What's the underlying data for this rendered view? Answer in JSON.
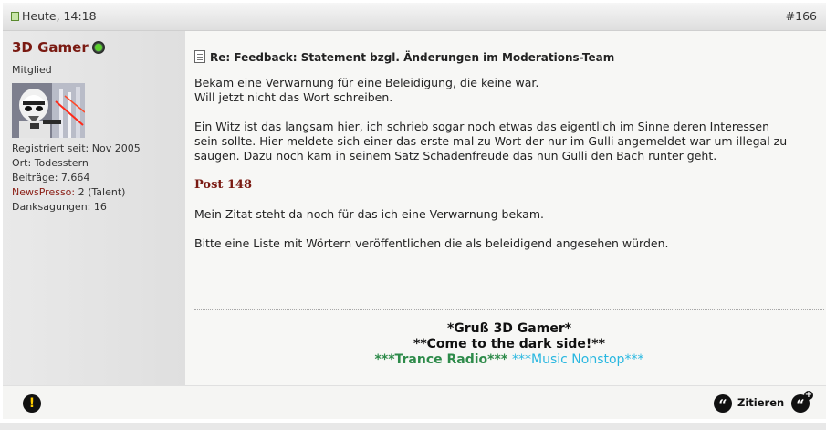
{
  "header": {
    "date": "Heute, 14:18",
    "post_number": "#166"
  },
  "user": {
    "name": "3D Gamer",
    "title": "Mitglied",
    "status": "online",
    "stats": {
      "registered_label": "Registriert seit:",
      "registered_value": "Nov 2005",
      "location_label": "Ort:",
      "location_value": "Todesstern",
      "posts_label": "Beiträge:",
      "posts_value": "7.664",
      "newspresso_label": "NewsPresso:",
      "newspresso_value": "2 (Talent)",
      "thanks_label": "Danksagungen:",
      "thanks_value": "16"
    }
  },
  "post": {
    "title": "Re: Feedback: Statement bzgl. Änderungen im Moderations-Team",
    "line1": "Bekam eine Verwarnung für eine Beleidigung, die keine war.",
    "line2": "Will jetzt nicht das Wort schreiben.",
    "line3": "Ein Witz ist das langsam hier, ich schrieb sogar noch etwas das eigentlich im Sinne deren Interessen",
    "line4": "sein sollte. Hier meldete sich einer das erste mal zu Wort der nur im Gulli angemeldet war um illegal zu",
    "line5": "saugen. Dazu noch kam in seinem Satz Schadenfreude das nun Gulli den Bach runter geht.",
    "post_ref": "Post 148",
    "line6": "Mein Zitat steht da noch für das ich eine Verwarnung bekam.",
    "line7": "Bitte eine Liste mit Wörtern veröffentlichen die als beleidigend angesehen würden."
  },
  "signature": {
    "line1": "*Gruß 3D Gamer*",
    "line2": "**Come to the dark side!**",
    "trance": "***Trance Radio***",
    "nonstop": "***Music Nonstop***"
  },
  "footer": {
    "report_glyph": "!",
    "quote_label": "Zitieren"
  },
  "colors": {
    "username": "#7a1a12",
    "online": "#5cd12e",
    "trance": "#2e8b4a",
    "nonstop": "#29b7e0"
  },
  "icons": {
    "date": "post-date-icon",
    "online": "online-status-icon",
    "title": "document-icon",
    "report": "report-icon",
    "quote": "quote-icon",
    "multiquote": "multiquote-icon"
  }
}
